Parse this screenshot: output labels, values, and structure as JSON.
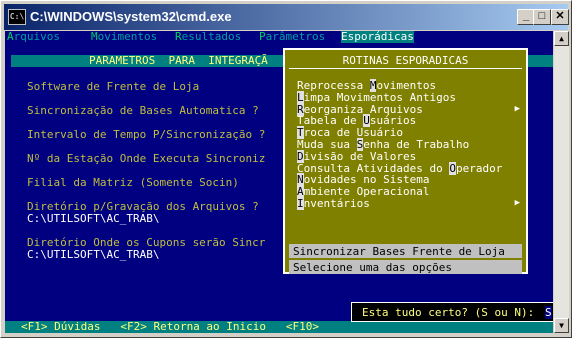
{
  "window": {
    "title": "C:\\WINDOWS\\system32\\cmd.exe",
    "icon_text": "C:\\"
  },
  "menubar": {
    "items": [
      {
        "hot": "A",
        "rest": "rquivos"
      },
      {
        "hot": "M",
        "rest": "ovimentos"
      },
      {
        "hot": "R",
        "rest": "esultados"
      },
      {
        "hot": "P",
        "rest": "arâmetros"
      },
      {
        "hot": "E",
        "rest": "sporádicas"
      }
    ]
  },
  "param_panel": {
    "title": "PARAMETROS  PARA  INTEGRAÇÃ",
    "labels": [
      "Software de Frente de Loja",
      "Sincronização de Bases Automatica ?",
      "Intervalo de Tempo P/Sincronização ?",
      "Nº da Estação Onde Executa Sincroniz",
      "Filial da Matriz (Somente Socin)",
      "Diretório p/Gravação dos Arquivos ?",
      "Diretório Onde os Cupons serão Sincr"
    ],
    "paths": [
      "C:\\UTILSOFT\\AC_TRAB\\",
      "C:\\UTILSOFT\\AC_TRAB\\"
    ]
  },
  "popup": {
    "title": "ROTINAS ESPORADICAS",
    "options": [
      {
        "pre": "Reprocessa ",
        "hot": "M",
        "post": "ovimentos",
        "sub": false
      },
      {
        "pre": "",
        "hot": "L",
        "post": "impa Movimentos Antigos",
        "sub": false
      },
      {
        "pre": "",
        "hot": "R",
        "post": "eorganiza Arquivos",
        "sub": true
      },
      {
        "pre": "Tabela de ",
        "hot": "U",
        "post": "suários",
        "sub": false
      },
      {
        "pre": "",
        "hot": "T",
        "post": "roca de Usuário",
        "sub": false
      },
      {
        "pre": "Muda sua ",
        "hot": "S",
        "post": "enha de Trabalho",
        "sub": false
      },
      {
        "pre": "",
        "hot": "D",
        "post": "ivisão de Valores",
        "sub": false
      },
      {
        "pre": "Consulta Atividades do ",
        "hot": "O",
        "post": "perador",
        "sub": false
      },
      {
        "pre": "",
        "hot": "N",
        "post": "ovidades no Sistema",
        "sub": false
      },
      {
        "pre": "",
        "hot": "A",
        "post": "mbiente Operacional",
        "sub": false
      },
      {
        "pre": "",
        "hot": "I",
        "post": "nventários",
        "sub": true
      }
    ],
    "selected": "Sincronizar Bases Frente de Loja",
    "footer": "Selecione uma das opções"
  },
  "status_bar": "<F1> Dúvidas   <F2> Retorna ao Inicio   <F10>",
  "confirm": {
    "question": "Esta tudo certo? (S ou N):",
    "answer": "S"
  }
}
